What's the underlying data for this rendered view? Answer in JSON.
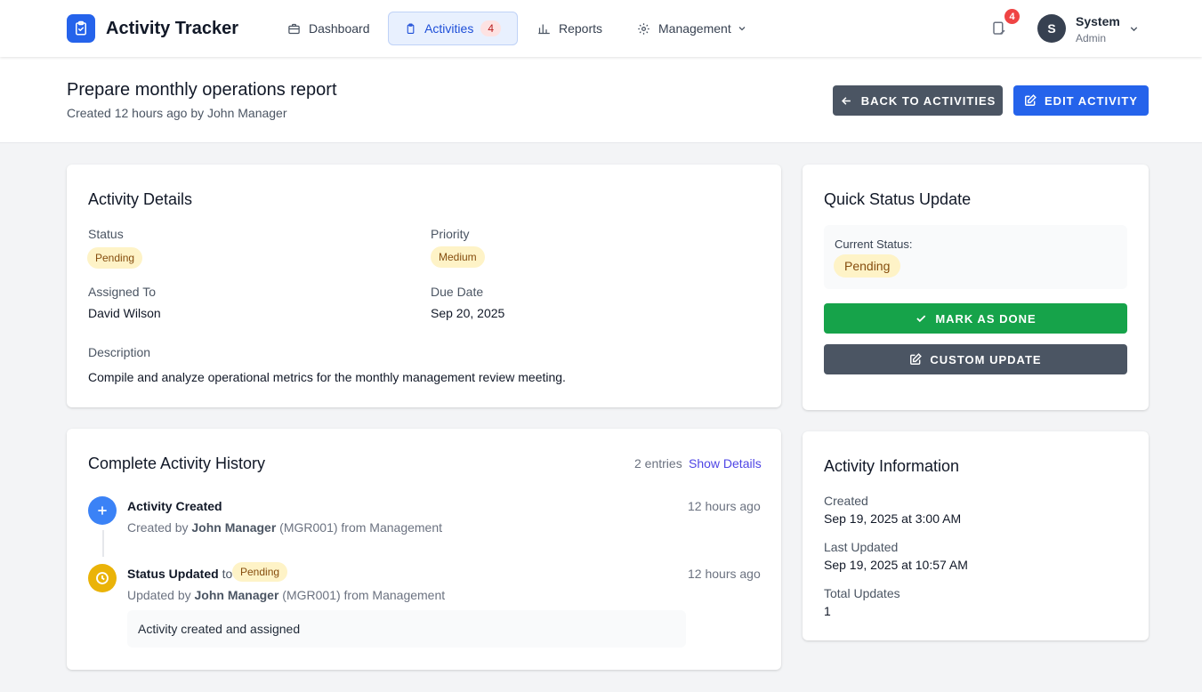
{
  "app": {
    "title": "Activity Tracker"
  },
  "nav": {
    "items": [
      {
        "label": "Dashboard",
        "icon": "briefcase-icon"
      },
      {
        "label": "Activities",
        "icon": "clipboard-icon",
        "badge": "4",
        "active": true
      },
      {
        "label": "Reports",
        "icon": "bar-chart-icon"
      },
      {
        "label": "Management",
        "icon": "gear-icon",
        "dropdown": true
      }
    ],
    "notification_count": "4",
    "user": {
      "initial": "S",
      "name": "System",
      "role": "Admin"
    }
  },
  "header": {
    "title": "Prepare monthly operations report",
    "subtitle": "Created 12 hours ago by John Manager",
    "back_label": "Back to Activities",
    "edit_label": "Edit Activity"
  },
  "details": {
    "title": "Activity Details",
    "status_label": "Status",
    "status_value": "Pending",
    "priority_label": "Priority",
    "priority_value": "Medium",
    "assigned_label": "Assigned To",
    "assigned_value": "David Wilson",
    "due_label": "Due Date",
    "due_value": "Sep 20, 2025",
    "description_label": "Description",
    "description_value": "Compile and analyze operational metrics for the monthly management review meeting."
  },
  "quick_status": {
    "title": "Quick Status Update",
    "current_label": "Current Status:",
    "current_value": "Pending",
    "done_label": "Mark as Done",
    "custom_label": "Custom Update"
  },
  "history": {
    "title": "Complete Activity History",
    "count": "2 entries",
    "toggle_label": "Show Details",
    "entries": [
      {
        "title": "Activity Created",
        "time": "12 hours ago",
        "prefix": "Created by",
        "actor": "John Manager",
        "suffix": "(MGR001) from Management"
      },
      {
        "title": "Status Updated",
        "connector": "to",
        "status": "Pending",
        "time": "12 hours ago",
        "prefix": "Updated by",
        "actor": "John Manager",
        "suffix": "(MGR001) from Management",
        "note": "Activity created and assigned"
      }
    ]
  },
  "info": {
    "title": "Activity Information",
    "created_label": "Created",
    "created_value": "Sep 19, 2025 at 3:00 AM",
    "updated_label": "Last Updated",
    "updated_value": "Sep 19, 2025 at 10:57 AM",
    "total_label": "Total Updates",
    "total_value": "1"
  },
  "colors": {
    "primary": "#2563eb",
    "success": "#16a34a",
    "secondary": "#4b5563",
    "warning": "#eab308",
    "badge": "#ef4444"
  }
}
